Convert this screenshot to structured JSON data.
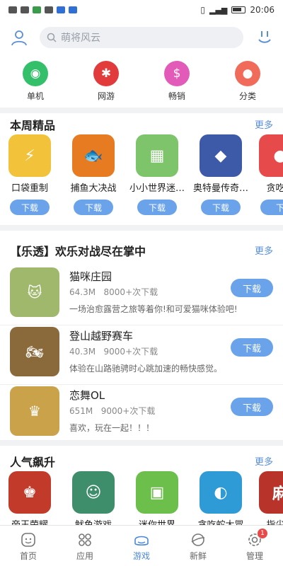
{
  "status": {
    "time": "20:06"
  },
  "search": {
    "placeholder": "萌将风云"
  },
  "categories": [
    {
      "label": "单机",
      "color": "#34c06a",
      "glyph": "🎮"
    },
    {
      "label": "网游",
      "color": "#e23b3b",
      "glyph": "🐾"
    },
    {
      "label": "畅销",
      "color": "#e25bb8",
      "glyph": "$"
    },
    {
      "label": "分类",
      "color": "#f06b5a",
      "glyph": "🎨"
    }
  ],
  "weekly": {
    "title": "本周精品",
    "more": "更多",
    "items": [
      {
        "name": "口袋重制",
        "btn": "下载",
        "color": "#f2c23a"
      },
      {
        "name": "捕鱼大决战",
        "btn": "下载",
        "color": "#e77b22"
      },
      {
        "name": "小小世界迷…",
        "btn": "下载",
        "color": "#7ec46b"
      },
      {
        "name": "奥特曼传奇…",
        "btn": "下载",
        "color": "#3d5aa8"
      },
      {
        "name": "贪吃蛇",
        "btn": "下",
        "color": "#e64a4a"
      }
    ]
  },
  "featured": {
    "title": "【乐透】欢乐对战尽在掌中",
    "more": "更多",
    "items": [
      {
        "name": "猫咪庄园",
        "size": "64.3M",
        "downloads": "8000+次下载",
        "desc": "一场治愈露营之旅等着你!和可爱猫咪体验吧!",
        "btn": "下载",
        "color": "#9fb86b"
      },
      {
        "name": "登山越野赛车",
        "size": "40.3M",
        "downloads": "9000+次下载",
        "desc": "体验在山路驰骋时心跳加速的畅快感觉。",
        "btn": "下载",
        "color": "#8a6a3a"
      },
      {
        "name": "恋舞OL",
        "size": "651M",
        "downloads": "9000+次下载",
        "desc": "喜欢，玩在一起！！！",
        "btn": "下载",
        "color": "#c9a24a"
      }
    ]
  },
  "popular": {
    "title": "人气飙升",
    "more": "更多",
    "items": [
      {
        "name": "帝王荣耀",
        "color": "#c23a2a"
      },
      {
        "name": "鱿鱼游戏",
        "color": "#3f8e6b"
      },
      {
        "name": "迷你世界",
        "color": "#6cbf4a"
      },
      {
        "name": "贪吃蛇大冒",
        "color": "#2e9bd6"
      },
      {
        "name": "指尖四",
        "color": "#b8332a"
      }
    ]
  },
  "tabs": [
    {
      "label": "首页"
    },
    {
      "label": "应用"
    },
    {
      "label": "游戏"
    },
    {
      "label": "新鲜"
    },
    {
      "label": "管理"
    }
  ],
  "badge": "1"
}
